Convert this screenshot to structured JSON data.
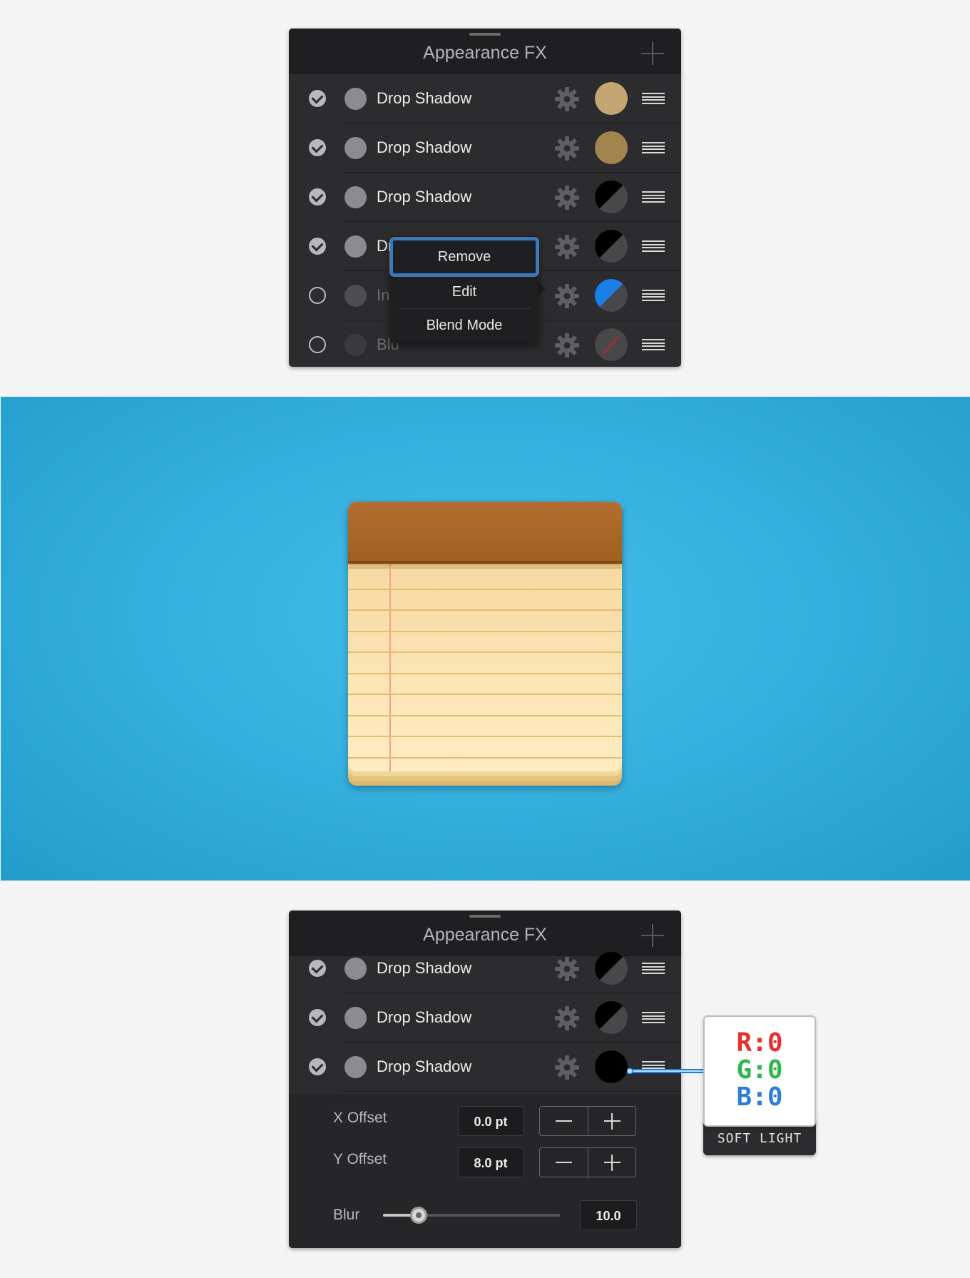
{
  "colors": {
    "accent": "#1a7fe6",
    "panel": "#2c2c2e",
    "header": "#1f1f21",
    "scene": "#36b0df",
    "red": "#e8302f",
    "green": "#2fb84a",
    "blue": "#2d7fd4"
  },
  "panel1": {
    "title": "Appearance FX",
    "rows": [
      {
        "label": "Drop Shadow",
        "checked": true,
        "swatch": "solid",
        "color": "#c4a673"
      },
      {
        "label": "Drop Shadow",
        "checked": true,
        "swatch": "solid",
        "color": "#a2844e"
      },
      {
        "label": "Drop Shadow",
        "checked": true,
        "swatch": "split",
        "color": "#000000"
      },
      {
        "label": "Dr",
        "checked": true,
        "swatch": "split",
        "color": "#000000"
      },
      {
        "label": "In",
        "checked": false,
        "swatch": "split",
        "color": "#1a7fe6"
      },
      {
        "label": "Blu",
        "checked": false,
        "swatch": "slash",
        "color": "#3a3a3c"
      }
    ],
    "context_menu": {
      "items": [
        "Remove",
        "Edit",
        "Blend Mode"
      ]
    }
  },
  "panel2": {
    "title": "Appearance FX",
    "rows": [
      {
        "label": "Drop Shadow",
        "checked": true,
        "swatch": "split",
        "color": "#000000"
      },
      {
        "label": "Drop Shadow",
        "checked": true,
        "swatch": "split",
        "color": "#000000"
      },
      {
        "label": "Drop Shadow",
        "checked": true,
        "swatch": "solid",
        "color": "#000000"
      }
    ],
    "settings": {
      "x_offset": {
        "label": "X Offset",
        "value": "0.0 pt"
      },
      "y_offset": {
        "label": "Y Offset",
        "value": "8.0 pt"
      },
      "blur": {
        "label": "Blur",
        "value": "10.0",
        "level": 0.2
      }
    }
  },
  "tooltip": {
    "r": "R:0",
    "g": "G:0",
    "b": "B:0",
    "mode": "SOFT LIGHT"
  }
}
